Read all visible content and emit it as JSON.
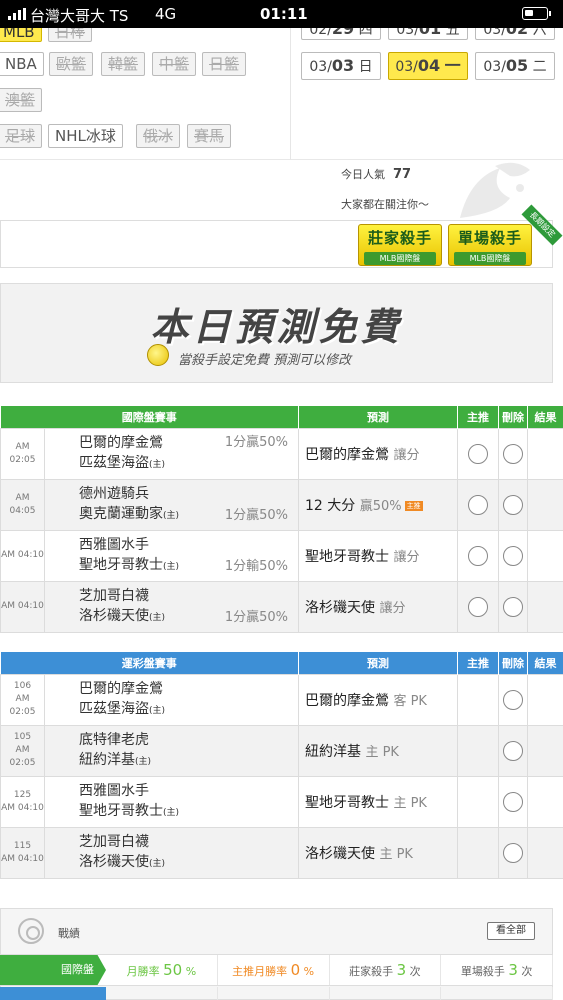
{
  "status": {
    "carrier": "台灣大哥大 TS",
    "network": "4G",
    "time": "01:11"
  },
  "sports": {
    "row1": [
      {
        "label": "MLB",
        "state": "active"
      },
      {
        "label": "日棒",
        "state": "disabled"
      }
    ],
    "row2": [
      {
        "label": "NBA",
        "state": "normal"
      },
      {
        "label": "歐籃",
        "state": "disabled"
      },
      {
        "label": "韓籃",
        "state": "disabled"
      },
      {
        "label": "中籃",
        "state": "disabled"
      },
      {
        "label": "日籃",
        "state": "disabled"
      }
    ],
    "row3": [
      {
        "label": "澳籃",
        "state": "disabled"
      }
    ],
    "row4": [
      {
        "label": "足球",
        "state": "disabled"
      },
      {
        "label": "NHL冰球",
        "state": "normal"
      },
      {
        "label": "俄冰",
        "state": "disabled"
      },
      {
        "label": "賽馬",
        "state": "disabled"
      }
    ]
  },
  "dates": {
    "row1": [
      {
        "month": "02/",
        "day": "29",
        "weekday": "四"
      },
      {
        "month": "03/",
        "day": "01",
        "weekday": "五"
      },
      {
        "month": "03/",
        "day": "02",
        "weekday": "六"
      }
    ],
    "row2": [
      {
        "month": "03/",
        "day": "03",
        "weekday": "日"
      },
      {
        "month": "03/",
        "day": "04",
        "weekday": "一",
        "today": true
      },
      {
        "month": "03/",
        "day": "05",
        "weekday": "二"
      }
    ]
  },
  "popularity": {
    "label": "今日人氣",
    "value": "77",
    "watching": "大家都在關注你～"
  },
  "killers": {
    "banker": {
      "title": "莊家殺手",
      "sub": "MLB國際盤"
    },
    "single": {
      "title": "單場殺手",
      "sub": "MLB國際盤"
    },
    "long_term": "長期設定"
  },
  "free_banner": {
    "title": "本日預測免費",
    "subtitle": "當殺手設定免費 預測可以修改"
  },
  "intl_table": {
    "headers": {
      "match": "國際盤賽事",
      "predict": "預測",
      "main": "主推",
      "delete": "刪除",
      "result": "結果"
    },
    "rows": [
      {
        "no": "",
        "ampm": "AM",
        "time": "02:05",
        "away": "巴爾的摩金鶯",
        "home": "匹茲堡海盜",
        "home_mark": "(主)",
        "odds_top": "1分贏50%",
        "odds_bottom": "",
        "pick": "巴爾的摩金鶯",
        "pick_note": "讓分",
        "flag": ""
      },
      {
        "no": "",
        "ampm": "AM",
        "time": "04:05",
        "away": "德州遊騎兵",
        "home": "奧克蘭運動家",
        "home_mark": "(主)",
        "odds_top": "",
        "odds_bottom": "1分贏50%",
        "pick": "12 大分",
        "pick_note": "贏50%",
        "flag": "主推"
      },
      {
        "no": "",
        "ampm": "",
        "time": "AM 04:10",
        "away": "西雅圖水手",
        "home": "聖地牙哥教士",
        "home_mark": "(主)",
        "odds_top": "",
        "odds_bottom": "1分輸50%",
        "pick": "聖地牙哥教士",
        "pick_note": "讓分",
        "flag": ""
      },
      {
        "no": "",
        "ampm": "",
        "time": "AM 04:10",
        "away": "芝加哥白襪",
        "home": "洛杉磯天使",
        "home_mark": "(主)",
        "odds_top": "",
        "odds_bottom": "1分贏50%",
        "pick": "洛杉磯天使",
        "pick_note": "讓分",
        "flag": ""
      }
    ]
  },
  "lottery_table": {
    "headers": {
      "match": "運彩盤賽事",
      "predict": "預測",
      "main": "主推",
      "delete": "刪除",
      "result": "結果"
    },
    "rows": [
      {
        "no": "106",
        "ampm": "AM",
        "time": "02:05",
        "away": "巴爾的摩金鶯",
        "home": "匹茲堡海盜",
        "home_mark": "(主)",
        "odds_top": "",
        "odds_bottom": "",
        "pick": "巴爾的摩金鶯",
        "pick_note": "客 PK",
        "flag": ""
      },
      {
        "no": "105",
        "ampm": "AM",
        "time": "02:05",
        "away": "底特律老虎",
        "home": "紐約洋基",
        "home_mark": "(主)",
        "odds_top": "",
        "odds_bottom": "",
        "pick": "紐約洋基",
        "pick_note": "主 PK",
        "flag": ""
      },
      {
        "no": "125",
        "ampm": "",
        "time": "AM 04:10",
        "away": "西雅圖水手",
        "home": "聖地牙哥教士",
        "home_mark": "(主)",
        "odds_top": "",
        "odds_bottom": "",
        "pick": "聖地牙哥教士",
        "pick_note": "主 PK",
        "flag": ""
      },
      {
        "no": "115",
        "ampm": "",
        "time": "AM 04:10",
        "away": "芝加哥白襪",
        "home": "洛杉磯天使",
        "home_mark": "(主)",
        "odds_top": "",
        "odds_bottom": "",
        "pick": "洛杉磯天使",
        "pick_note": "主 PK",
        "flag": ""
      }
    ]
  },
  "record": {
    "title": "戰績",
    "view_all": "看全部",
    "intl": {
      "label": "國際盤",
      "monthly_win_label": "月勝率",
      "monthly_win": "50",
      "main_monthly_label": "主推月勝率",
      "main_monthly": "0",
      "banker_label": "莊家殺手",
      "banker": "3",
      "single_label": "單場殺手",
      "single": "3",
      "percent": "%",
      "times": "次"
    }
  },
  "colors": {
    "active_yellow": "#ffe94d",
    "intl_green": "#3fae3f",
    "lottery_blue": "#3d8fd6",
    "win_green": "#6cc644",
    "main_orange": "#f08a24"
  }
}
